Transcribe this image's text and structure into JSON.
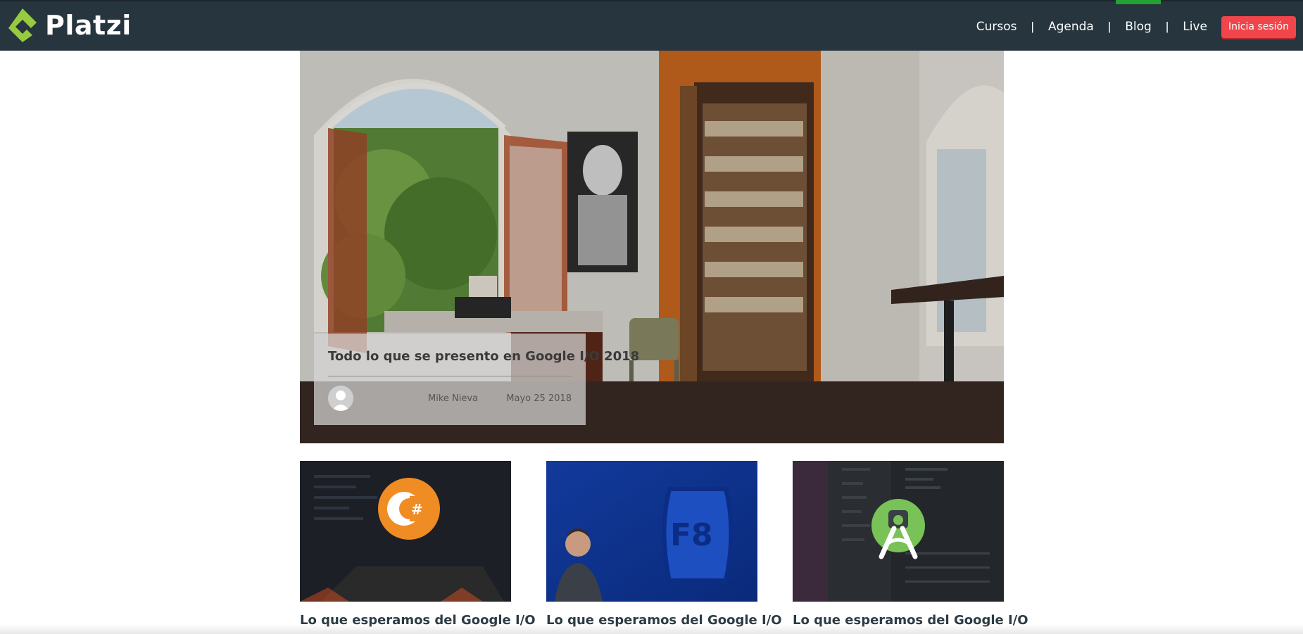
{
  "brand": {
    "name": "Platzi",
    "colors": {
      "header_bg": "#26353e",
      "logo_green": "#98ca3f",
      "accent_red": "#f0454b",
      "active_green": "#22a233"
    }
  },
  "nav": {
    "items": [
      {
        "label": "Cursos",
        "active": false
      },
      {
        "label": "Agenda",
        "active": false
      },
      {
        "label": "Blog",
        "active": true
      },
      {
        "label": "Live",
        "active": false
      }
    ],
    "separator": "|",
    "login_label": "Inicia sesión"
  },
  "hero": {
    "title": "Todo lo que se presento en Google I/O 2018",
    "author": "Mike Nieva",
    "date": "Mayo 25 2018",
    "image": "study-room-photo"
  },
  "articles": [
    {
      "title": "Lo que esperamos del Google I/O",
      "image": "csharp-logo-laptop"
    },
    {
      "title": "Lo que esperamos del Google I/O",
      "image": "f8-conference-speaker"
    },
    {
      "title": "Lo que esperamos del Google I/O",
      "image": "android-studio-logo"
    }
  ]
}
